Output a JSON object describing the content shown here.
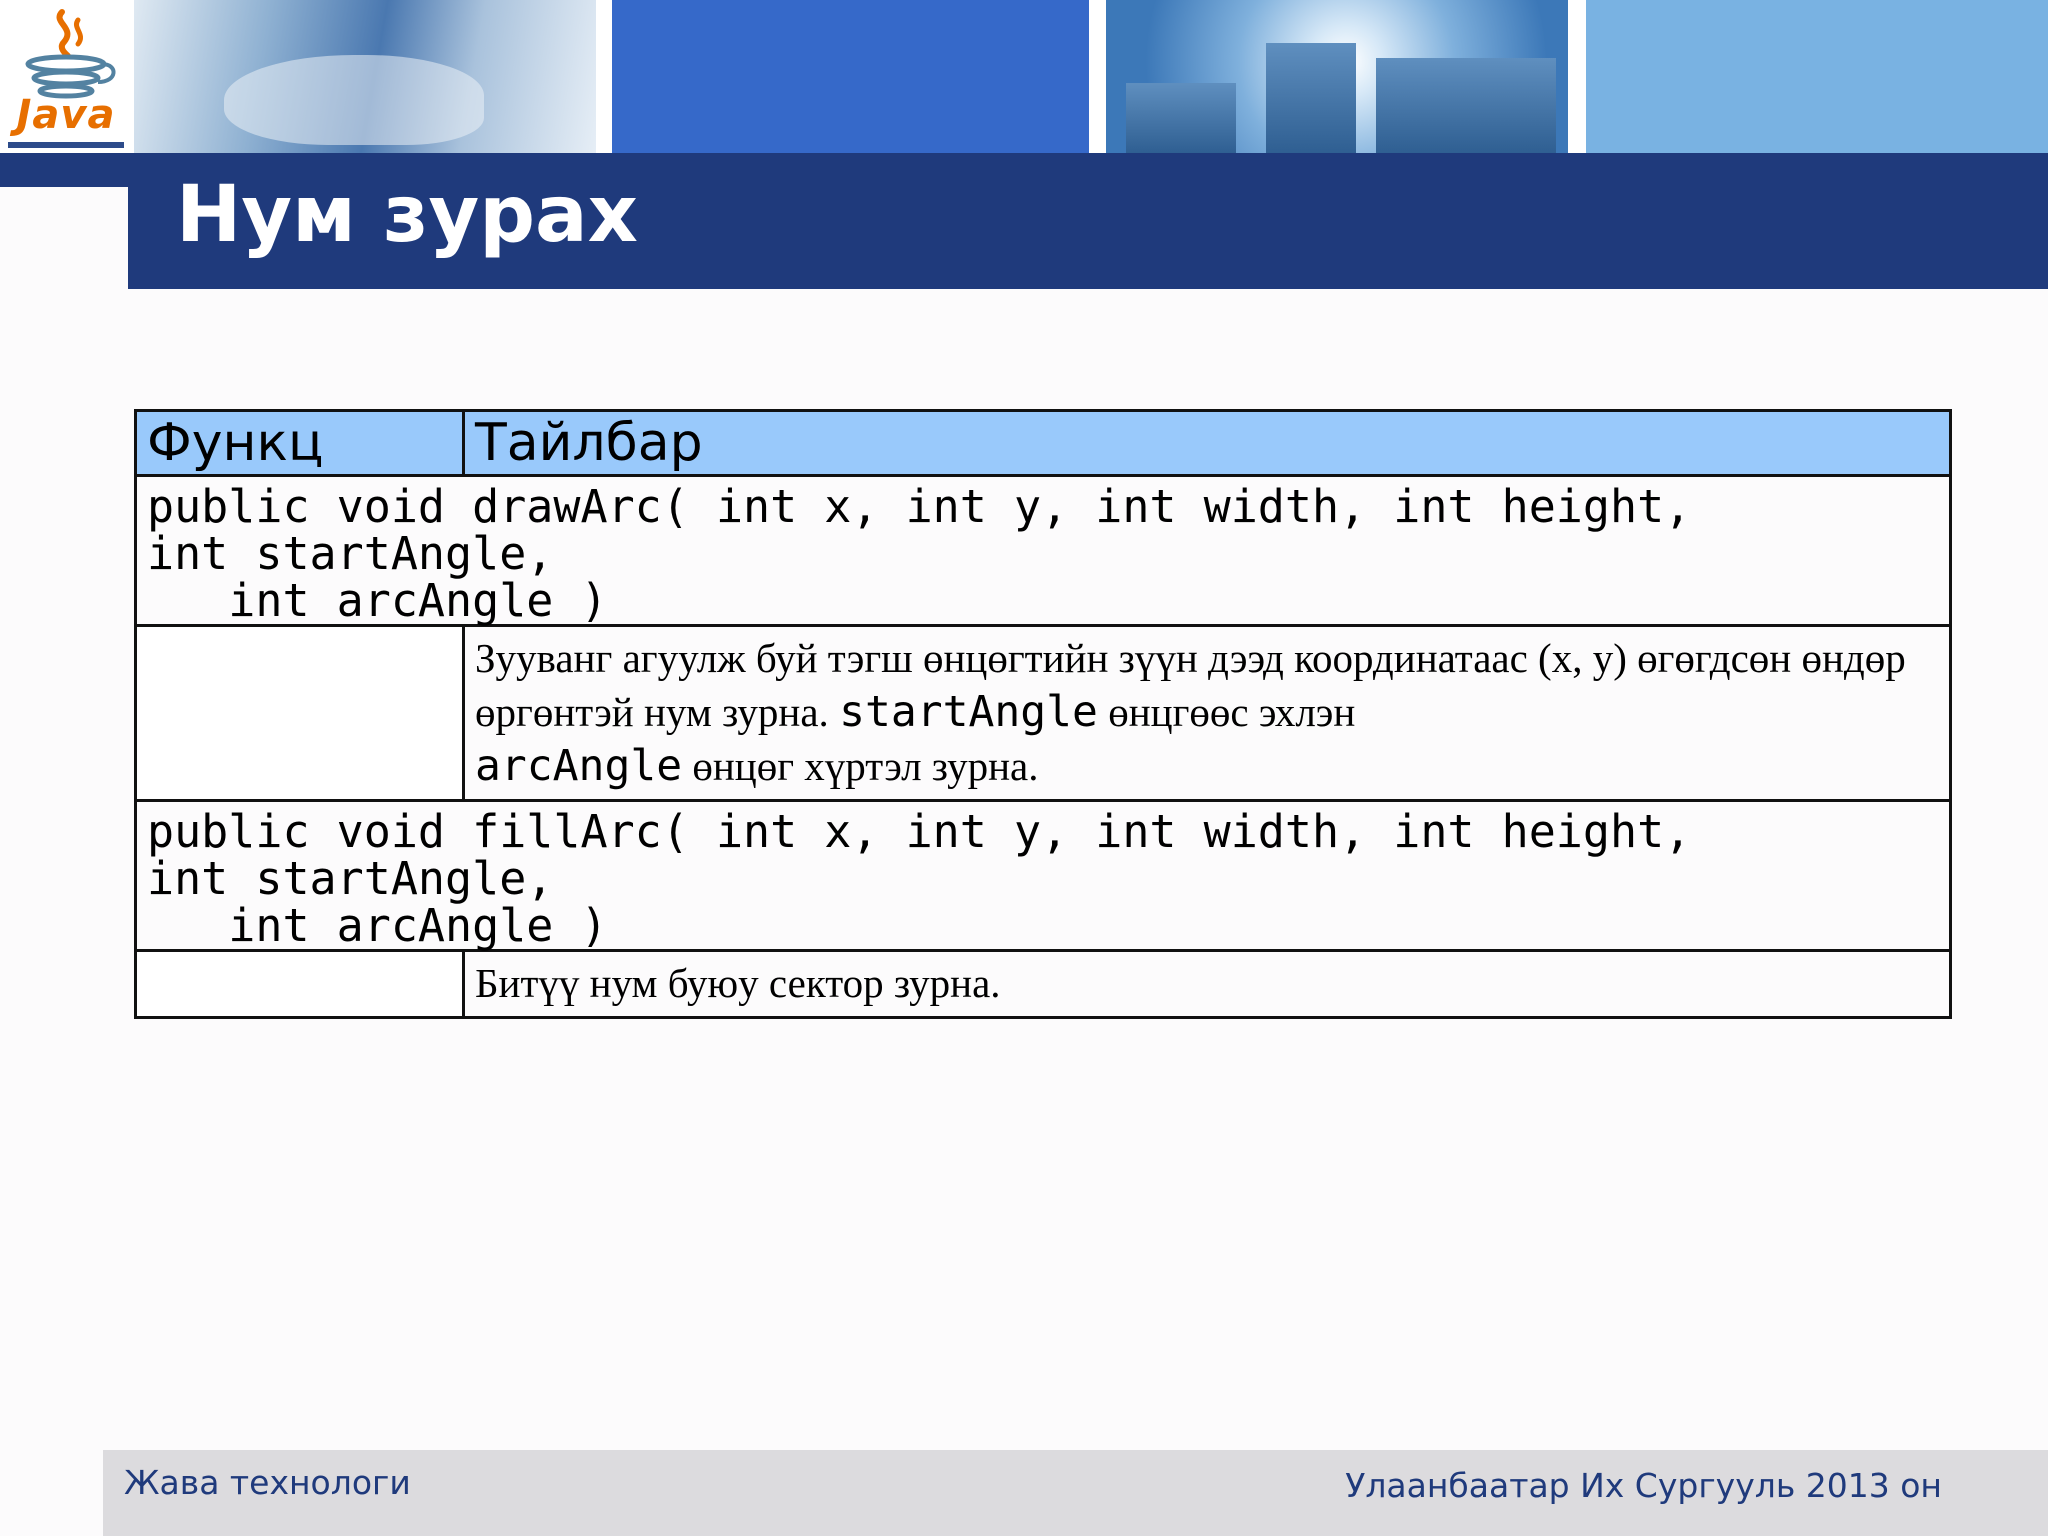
{
  "slide": {
    "logo_text": "Java",
    "title": "Нум зурах"
  },
  "table": {
    "headers": [
      "Функц",
      "Тайлбар"
    ],
    "rows": [
      {
        "signature": "public void drawArc( int x, int y, int width, int height,\nint startAngle,\n   int arcAngle )",
        "description": {
          "part1": "Зууванг агуулж буй тэгш өнцөгтийн зүүн дээд координатаас (x, y) өгөгдсөн өндөр өргөнтэй нум зурна. ",
          "code1": "startAngle",
          "part2": " өнцгөөс эхлэн ",
          "code2": "arcAngle",
          "part3": " өнцөг хүртэл зурна."
        }
      },
      {
        "signature": "public void fillArc( int x, int y, int width, int height,\nint startAngle,\n   int arcAngle )",
        "description": {
          "part1": "Битүү нум буюу сектор зурна."
        }
      }
    ]
  },
  "footer": {
    "left": "Жава технологи",
    "right": "Улаанбаатар Их Сургууль 2013 он"
  },
  "colors": {
    "title_bar": "#1f3a7c",
    "table_header": "#99c9fb",
    "footer_bg": "#dcdbde",
    "footer_text": "#1f3a7c",
    "logo_orange": "#e76f00"
  }
}
